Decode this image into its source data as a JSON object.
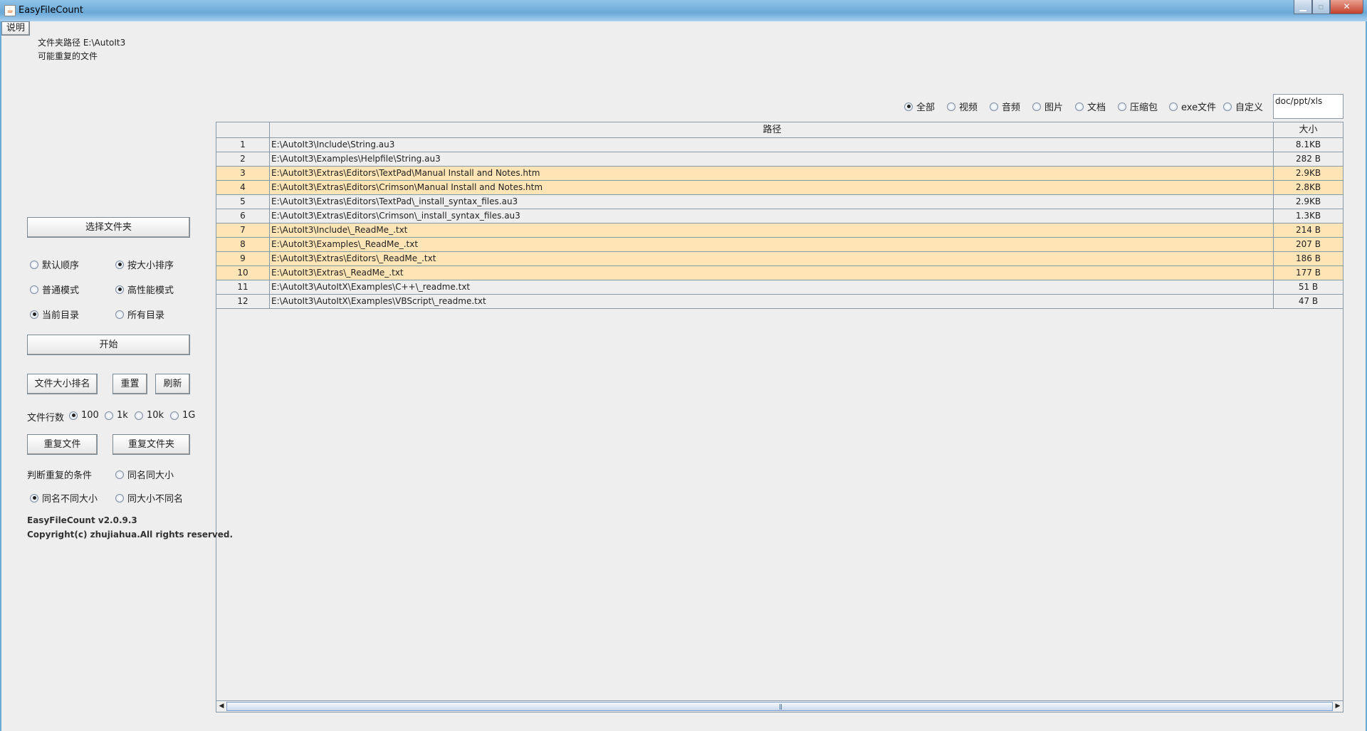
{
  "window": {
    "title": "EasyFileCount"
  },
  "help_button": "说明",
  "folder_path_label": "文件夹路径",
  "folder_path_value": "E:\\AutoIt3",
  "result_label": "可能重复的文件",
  "file_types": [
    {
      "label": "全部",
      "checked": true
    },
    {
      "label": "视频",
      "checked": false
    },
    {
      "label": "音频",
      "checked": false
    },
    {
      "label": "图片",
      "checked": false
    },
    {
      "label": "文档",
      "checked": false
    },
    {
      "label": "压缩包",
      "checked": false
    },
    {
      "label": "exe文件",
      "checked": false
    },
    {
      "label": "自定义",
      "checked": false
    }
  ],
  "custom_filter_value": "doc/ppt/xls",
  "table": {
    "headers": [
      "",
      "路径",
      "大小"
    ],
    "rows": [
      {
        "n": "1",
        "path": "E:\\AutoIt3\\Include\\String.au3",
        "size": "8.1KB",
        "hl": false
      },
      {
        "n": "2",
        "path": "E:\\AutoIt3\\Examples\\Helpfile\\String.au3",
        "size": "282 B",
        "hl": false
      },
      {
        "n": "3",
        "path": "E:\\AutoIt3\\Extras\\Editors\\TextPad\\Manual Install and Notes.htm",
        "size": "2.9KB",
        "hl": true
      },
      {
        "n": "4",
        "path": "E:\\AutoIt3\\Extras\\Editors\\Crimson\\Manual Install and Notes.htm",
        "size": "2.8KB",
        "hl": true
      },
      {
        "n": "5",
        "path": "E:\\AutoIt3\\Extras\\Editors\\TextPad\\_install_syntax_files.au3",
        "size": "2.9KB",
        "hl": false
      },
      {
        "n": "6",
        "path": "E:\\AutoIt3\\Extras\\Editors\\Crimson\\_install_syntax_files.au3",
        "size": "1.3KB",
        "hl": false
      },
      {
        "n": "7",
        "path": "E:\\AutoIt3\\Include\\_ReadMe_.txt",
        "size": "214 B",
        "hl": true
      },
      {
        "n": "8",
        "path": "E:\\AutoIt3\\Examples\\_ReadMe_.txt",
        "size": "207 B",
        "hl": true
      },
      {
        "n": "9",
        "path": "E:\\AutoIt3\\Extras\\Editors\\_ReadMe_.txt",
        "size": "186 B",
        "hl": true
      },
      {
        "n": "10",
        "path": "E:\\AutoIt3\\Extras\\_ReadMe_.txt",
        "size": "177 B",
        "hl": true
      },
      {
        "n": "11",
        "path": "E:\\AutoIt3\\AutoItX\\Examples\\C++\\_readme.txt",
        "size": "51 B",
        "hl": false
      },
      {
        "n": "12",
        "path": "E:\\AutoIt3\\AutoItX\\Examples\\VBScript\\_readme.txt",
        "size": "47 B",
        "hl": false
      }
    ]
  },
  "left": {
    "select_folder": "选择文件夹",
    "sort_default": "默认顺序",
    "sort_size": "按大小排序",
    "mode_normal": "普通模式",
    "mode_fast": "高性能模式",
    "dir_current": "当前目录",
    "dir_all": "所有目录",
    "start": "开始",
    "size_rank": "文件大小排名",
    "reset": "重置",
    "refresh": "刷新",
    "rows_label": "文件行数",
    "rows_100": "100",
    "rows_1k": "1k",
    "rows_10k": "10k",
    "rows_1g": "1G",
    "dup_files": "重复文件",
    "dup_folders": "重复文件夹",
    "cond_label": "判断重复的条件",
    "cond_same_name_size": "同名同大小",
    "cond_same_name_diff_size": "同名不同大小",
    "cond_same_size_diff_name": "同大小不同名",
    "version": "EasyFileCount v2.0.9.3",
    "copyright": "Copyright(c) zhujiahua.All rights reserved."
  },
  "colors": {
    "highlight_row": "#ffe4b5",
    "grid": "#8a99aa"
  }
}
